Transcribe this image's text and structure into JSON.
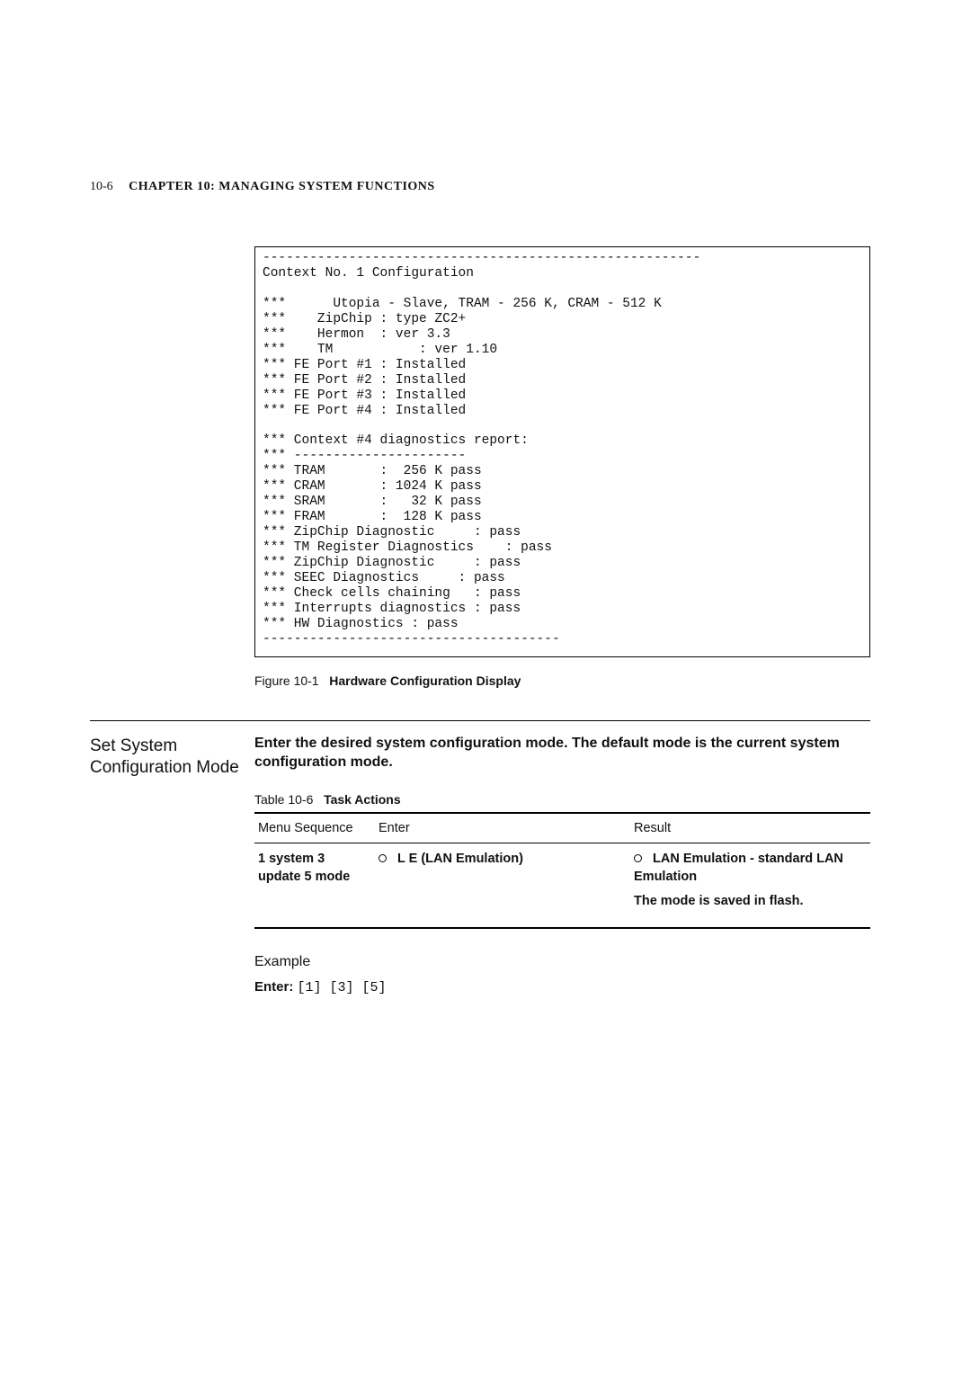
{
  "page": {
    "number": "10-6",
    "chapter": "CHAPTER 10:",
    "title": "MANAGING SYSTEM FUNCTIONS"
  },
  "terminal": {
    "lines": [
      "--------------------------------------------------------",
      "Context No. 1 Configuration",
      "",
      "***      Utopia - Slave, TRAM - 256 K, CRAM - 512 K",
      "***    ZipChip : type ZC2+",
      "***    Hermon  : ver 3.3",
      "***    TM           : ver 1.10",
      "*** FE Port #1 : Installed",
      "*** FE Port #2 : Installed",
      "*** FE Port #3 : Installed",
      "*** FE Port #4 : Installed",
      "",
      "*** Context #4 diagnostics report:",
      "*** ----------------------",
      "*** TRAM       :  256 K pass",
      "*** CRAM       : 1024 K pass",
      "*** SRAM       :   32 K pass",
      "*** FRAM       :  128 K pass",
      "*** ZipChip Diagnostic     : pass",
      "*** TM Register Diagnostics    : pass",
      "*** ZipChip Diagnostic     : pass",
      "*** SEEC Diagnostics     : pass",
      "*** Check cells chaining   : pass",
      "*** Interrupts diagnostics : pass",
      "*** HW Diagnostics : pass",
      "--------------------------------------"
    ]
  },
  "figure": {
    "num": "Figure 10-1",
    "title": "Hardware Configuration Display"
  },
  "section": {
    "side_title": "Set System Configuration Mode",
    "intro": "Enter the desired system configuration mode. The default mode is the current system configuration mode.",
    "table": {
      "caption_num": "Table 10-6",
      "caption_title": "Task Actions",
      "headers": {
        "col1": "Menu Sequence",
        "col2": "Enter",
        "col3": "Result"
      },
      "row": {
        "menu": "1  system  3  update  5  mode",
        "enter": "L  E   (LAN Emulation)",
        "result_bullet": "LAN Emulation - standard LAN Emulation",
        "result_note": "The mode is saved in flash."
      }
    },
    "example": {
      "heading": "Example",
      "label": "Enter:",
      "value": "[1]  [3]  [5]"
    }
  }
}
